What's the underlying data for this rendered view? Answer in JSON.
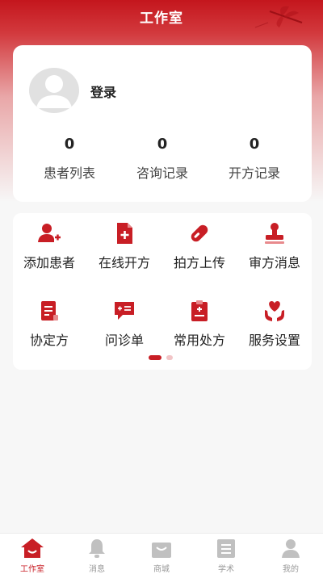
{
  "header": {
    "title": "工作室"
  },
  "profile": {
    "login_label": "登录",
    "stats": [
      {
        "value": "0",
        "label": "患者列表"
      },
      {
        "value": "0",
        "label": "咨询记录"
      },
      {
        "value": "0",
        "label": "开方记录"
      }
    ]
  },
  "functions": [
    {
      "label": "添加患者",
      "icon": "add-patient-icon"
    },
    {
      "label": "在线开方",
      "icon": "online-prescribe-icon"
    },
    {
      "label": "拍方上传",
      "icon": "pill-icon"
    },
    {
      "label": "审方消息",
      "icon": "stamp-icon"
    },
    {
      "label": "协定方",
      "icon": "document-icon"
    },
    {
      "label": "问诊单",
      "icon": "chat-form-icon"
    },
    {
      "label": "常用处方",
      "icon": "clipboard-icon"
    },
    {
      "label": "服务设置",
      "icon": "heart-hands-icon"
    }
  ],
  "pagination": {
    "page": 1,
    "total": 2
  },
  "tabbar": [
    {
      "label": "工作室",
      "icon": "home-icon",
      "active": true
    },
    {
      "label": "消息",
      "icon": "bell-icon",
      "active": false
    },
    {
      "label": "商城",
      "icon": "shopping-bag-icon",
      "active": false
    },
    {
      "label": "学术",
      "icon": "book-icon",
      "active": false
    },
    {
      "label": "我的",
      "icon": "user-icon",
      "active": false
    }
  ],
  "colors": {
    "brand": "#c81e25",
    "inactive_tab": "#b8b8b8"
  }
}
